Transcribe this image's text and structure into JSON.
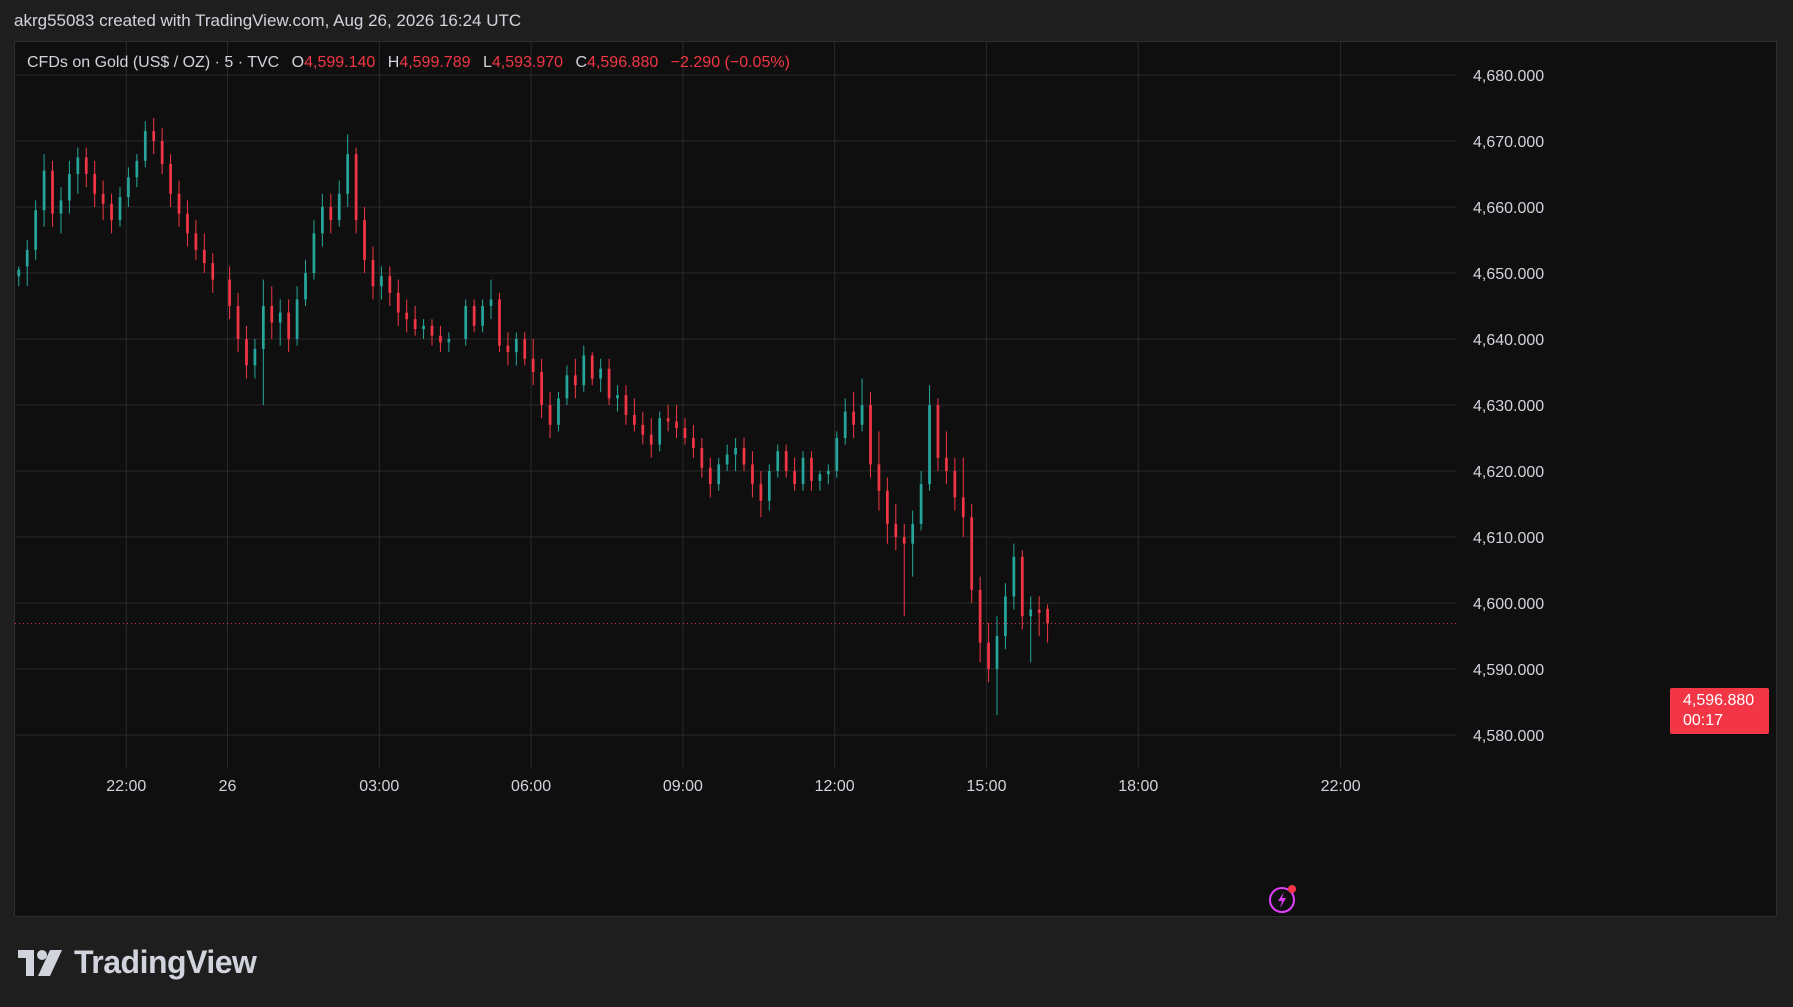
{
  "header": {
    "attribution": "akrg55083 created with TradingView.com, Aug 26, 2026 16:24 UTC"
  },
  "legend": {
    "symbol": "CFDs on Gold (US$ / OZ) · 5 · TVC",
    "open_label": "O",
    "open": "4,599.140",
    "high_label": "H",
    "high": "4,599.789",
    "low_label": "L",
    "low": "4,593.970",
    "close_label": "C",
    "close": "4,596.880",
    "change": "−2.290 (−0.05%)"
  },
  "price_badge": {
    "price": "4,596.880",
    "countdown": "00:17"
  },
  "brand": {
    "name": "TradingView"
  },
  "colors": {
    "up": "#26a69a",
    "down": "#f23645",
    "grid": "#2a2a2a",
    "background": "#0f0f0f",
    "text": "#d1d4dc",
    "bolt": "#e040fb"
  },
  "icons": {
    "alert": "lightning-icon",
    "logo": "tradingview-logo-icon"
  },
  "chart_data": {
    "type": "candlestick",
    "interval_minutes": 5,
    "ylim": [
      4575,
      4685
    ],
    "yticks": [
      4580,
      4590,
      4600,
      4610,
      4620,
      4630,
      4640,
      4650,
      4660,
      4670,
      4680
    ],
    "ytick_labels": [
      "4,580.000",
      "4,590.000",
      "4,600.000",
      "4,610.000",
      "4,620.000",
      "4,630.000",
      "4,640.000",
      "4,650.000",
      "4,660.000",
      "4,670.000",
      "4,680.000"
    ],
    "x_ticks": [
      {
        "label": "22:00",
        "hours": -2
      },
      {
        "label": "26",
        "hours": 0
      },
      {
        "label": "03:00",
        "hours": 3
      },
      {
        "label": "06:00",
        "hours": 6
      },
      {
        "label": "09:00",
        "hours": 9
      },
      {
        "label": "12:00",
        "hours": 12
      },
      {
        "label": "15:00",
        "hours": 15
      },
      {
        "label": "18:00",
        "hours": 18
      },
      {
        "label": "22:00",
        "hours": 22
      }
    ],
    "xlim_hours": [
      -4.2,
      24.3
    ],
    "last_price": 4596.88,
    "ohlc": [
      {
        "time": "Aug 25 19:50",
        "o": 4649.5,
        "h": 4651,
        "l": 4648,
        "c": 4650.5
      },
      {
        "time": "Aug 25 20:00",
        "o": 4651,
        "h": 4655,
        "l": 4648,
        "c": 4653.5
      },
      {
        "time": "Aug 25 20:10",
        "o": 4653.5,
        "h": 4661,
        "l": 4652,
        "c": 4659.5
      },
      {
        "time": "Aug 25 20:20",
        "o": 4659.5,
        "h": 4668,
        "l": 4657,
        "c": 4665.5
      },
      {
        "time": "Aug 25 20:30",
        "o": 4665.5,
        "h": 4667,
        "l": 4657,
        "c": 4659
      },
      {
        "time": "Aug 25 20:40",
        "o": 4659,
        "h": 4663,
        "l": 4656,
        "c": 4661
      },
      {
        "time": "Aug 25 20:50",
        "o": 4661,
        "h": 4667,
        "l": 4659,
        "c": 4665
      },
      {
        "time": "Aug 25 21:00",
        "o": 4665,
        "h": 4669,
        "l": 4662,
        "c": 4667.5
      },
      {
        "time": "Aug 25 21:10",
        "o": 4667.5,
        "h": 4669,
        "l": 4663,
        "c": 4665
      },
      {
        "time": "Aug 25 21:20",
        "o": 4665,
        "h": 4667,
        "l": 4660,
        "c": 4662
      },
      {
        "time": "Aug 25 21:30",
        "o": 4662,
        "h": 4664,
        "l": 4658,
        "c": 4660.5
      },
      {
        "time": "Aug 25 21:40",
        "o": 4660.5,
        "h": 4662,
        "l": 4656,
        "c": 4658
      },
      {
        "time": "Aug 25 21:50",
        "o": 4658,
        "h": 4663,
        "l": 4657,
        "c": 4661.5
      },
      {
        "time": "Aug 25 22:00",
        "o": 4661.5,
        "h": 4666,
        "l": 4660,
        "c": 4664.5
      },
      {
        "time": "Aug 25 22:10",
        "o": 4664.5,
        "h": 4668,
        "l": 4663,
        "c": 4667
      },
      {
        "time": "Aug 25 22:20",
        "o": 4667,
        "h": 4673,
        "l": 4666,
        "c": 4671.5
      },
      {
        "time": "Aug 25 22:30",
        "o": 4671.5,
        "h": 4673.5,
        "l": 4668,
        "c": 4670
      },
      {
        "time": "Aug 25 22:40",
        "o": 4670,
        "h": 4672,
        "l": 4665,
        "c": 4666.5
      },
      {
        "time": "Aug 25 22:50",
        "o": 4666.5,
        "h": 4668,
        "l": 4660,
        "c": 4662
      },
      {
        "time": "Aug 25 23:00",
        "o": 4662,
        "h": 4664,
        "l": 4657,
        "c": 4659
      },
      {
        "time": "Aug 25 23:10",
        "o": 4659,
        "h": 4661,
        "l": 4654,
        "c": 4656
      },
      {
        "time": "Aug 25 23:20",
        "o": 4656,
        "h": 4658,
        "l": 4652,
        "c": 4653.5
      },
      {
        "time": "Aug 25 23:30",
        "o": 4653.5,
        "h": 4656,
        "l": 4650,
        "c": 4651.5
      },
      {
        "time": "Aug 25 23:40",
        "o": 4651.5,
        "h": 4653,
        "l": 4647,
        "c": 4649
      },
      {
        "time": "Aug 26 00:00",
        "o": 4649,
        "h": 4651,
        "l": 4643,
        "c": 4645
      },
      {
        "time": "Aug 26 00:10",
        "o": 4645,
        "h": 4647,
        "l": 4638,
        "c": 4640
      },
      {
        "time": "Aug 26 00:20",
        "o": 4640,
        "h": 4642,
        "l": 4634,
        "c": 4636
      },
      {
        "time": "Aug 26 00:30",
        "o": 4636,
        "h": 4640,
        "l": 4634,
        "c": 4638.5
      },
      {
        "time": "Aug 26 00:40",
        "o": 4638.5,
        "h": 4649,
        "l": 4630,
        "c": 4645
      },
      {
        "time": "Aug 26 00:50",
        "o": 4645,
        "h": 4648,
        "l": 4640,
        "c": 4642.5
      },
      {
        "time": "Aug 26 01:00",
        "o": 4642.5,
        "h": 4646,
        "l": 4639,
        "c": 4644
      },
      {
        "time": "Aug 26 01:10",
        "o": 4644,
        "h": 4646,
        "l": 4638,
        "c": 4640
      },
      {
        "time": "Aug 26 01:20",
        "o": 4640,
        "h": 4648,
        "l": 4639,
        "c": 4646
      },
      {
        "time": "Aug 26 01:30",
        "o": 4646,
        "h": 4652,
        "l": 4645,
        "c": 4650
      },
      {
        "time": "Aug 26 01:40",
        "o": 4650,
        "h": 4658,
        "l": 4649,
        "c": 4656
      },
      {
        "time": "Aug 26 01:50",
        "o": 4656,
        "h": 4662,
        "l": 4654,
        "c": 4660
      },
      {
        "time": "Aug 26 02:00",
        "o": 4660,
        "h": 4662,
        "l": 4656,
        "c": 4658
      },
      {
        "time": "Aug 26 02:10",
        "o": 4658,
        "h": 4664,
        "l": 4657,
        "c": 4662
      },
      {
        "time": "Aug 26 02:20",
        "o": 4662,
        "h": 4671,
        "l": 4660,
        "c": 4668
      },
      {
        "time": "Aug 26 02:30",
        "o": 4668,
        "h": 4669,
        "l": 4656,
        "c": 4658
      },
      {
        "time": "Aug 26 02:40",
        "o": 4658,
        "h": 4660,
        "l": 4650,
        "c": 4652
      },
      {
        "time": "Aug 26 02:50",
        "o": 4652,
        "h": 4654,
        "l": 4646,
        "c": 4648
      },
      {
        "time": "Aug 26 03:00",
        "o": 4648,
        "h": 4651,
        "l": 4646,
        "c": 4649.5
      },
      {
        "time": "Aug 26 03:10",
        "o": 4649.5,
        "h": 4651,
        "l": 4645,
        "c": 4647
      },
      {
        "time": "Aug 26 03:20",
        "o": 4647,
        "h": 4649,
        "l": 4642,
        "c": 4644
      },
      {
        "time": "Aug 26 03:30",
        "o": 4644,
        "h": 4646,
        "l": 4641,
        "c": 4643
      },
      {
        "time": "Aug 26 03:40",
        "o": 4643,
        "h": 4645,
        "l": 4640.5,
        "c": 4641.5
      },
      {
        "time": "Aug 26 03:50",
        "o": 4641.5,
        "h": 4643,
        "l": 4640,
        "c": 4642
      },
      {
        "time": "Aug 26 04:00",
        "o": 4642,
        "h": 4643,
        "l": 4639,
        "c": 4640.5
      },
      {
        "time": "Aug 26 04:10",
        "o": 4640.5,
        "h": 4642,
        "l": 4638,
        "c": 4639.5
      },
      {
        "time": "Aug 26 04:20",
        "o": 4639.5,
        "h": 4641,
        "l": 4638,
        "c": 4640
      },
      {
        "time": "Aug 26 04:40",
        "o": 4640,
        "h": 4646,
        "l": 4639,
        "c": 4645
      },
      {
        "time": "Aug 26 04:50",
        "o": 4645,
        "h": 4646,
        "l": 4641,
        "c": 4642
      },
      {
        "time": "Aug 26 05:00",
        "o": 4642,
        "h": 4646,
        "l": 4641,
        "c": 4645
      },
      {
        "time": "Aug 26 05:10",
        "o": 4645,
        "h": 4649,
        "l": 4643,
        "c": 4646
      },
      {
        "time": "Aug 26 05:20",
        "o": 4646,
        "h": 4647,
        "l": 4638,
        "c": 4639
      },
      {
        "time": "Aug 26 05:30",
        "o": 4639,
        "h": 4641,
        "l": 4636,
        "c": 4638
      },
      {
        "time": "Aug 26 05:40",
        "o": 4638,
        "h": 4641,
        "l": 4636,
        "c": 4640
      },
      {
        "time": "Aug 26 05:50",
        "o": 4640,
        "h": 4641,
        "l": 4636,
        "c": 4637
      },
      {
        "time": "Aug 26 06:00",
        "o": 4637,
        "h": 4640,
        "l": 4633,
        "c": 4635
      },
      {
        "time": "Aug 26 06:10",
        "o": 4635,
        "h": 4637,
        "l": 4628,
        "c": 4630
      },
      {
        "time": "Aug 26 06:20",
        "o": 4630,
        "h": 4632,
        "l": 4625,
        "c": 4627
      },
      {
        "time": "Aug 26 06:30",
        "o": 4627,
        "h": 4632,
        "l": 4626,
        "c": 4631
      },
      {
        "time": "Aug 26 06:40",
        "o": 4631,
        "h": 4636,
        "l": 4630,
        "c": 4634.5
      },
      {
        "time": "Aug 26 06:50",
        "o": 4634.5,
        "h": 4637,
        "l": 4631,
        "c": 4633
      },
      {
        "time": "Aug 26 07:00",
        "o": 4633,
        "h": 4639,
        "l": 4632,
        "c": 4637.5
      },
      {
        "time": "Aug 26 07:10",
        "o": 4637.5,
        "h": 4638,
        "l": 4633,
        "c": 4634
      },
      {
        "time": "Aug 26 07:20",
        "o": 4634,
        "h": 4637,
        "l": 4632,
        "c": 4635.5
      },
      {
        "time": "Aug 26 07:30",
        "o": 4635.5,
        "h": 4637,
        "l": 4630,
        "c": 4631
      },
      {
        "time": "Aug 26 07:40",
        "o": 4631,
        "h": 4633,
        "l": 4629,
        "c": 4631.5
      },
      {
        "time": "Aug 26 07:50",
        "o": 4631.5,
        "h": 4633,
        "l": 4627,
        "c": 4628.5
      },
      {
        "time": "Aug 26 08:00",
        "o": 4628.5,
        "h": 4631,
        "l": 4626,
        "c": 4627
      },
      {
        "time": "Aug 26 08:10",
        "o": 4627,
        "h": 4629,
        "l": 4624,
        "c": 4625.5
      },
      {
        "time": "Aug 26 08:20",
        "o": 4625.5,
        "h": 4628,
        "l": 4622,
        "c": 4624
      },
      {
        "time": "Aug 26 08:30",
        "o": 4624,
        "h": 4629,
        "l": 4623,
        "c": 4628
      },
      {
        "time": "Aug 26 08:40",
        "o": 4628,
        "h": 4630,
        "l": 4626,
        "c": 4627.5
      },
      {
        "time": "Aug 26 08:50",
        "o": 4627.5,
        "h": 4630,
        "l": 4625,
        "c": 4626.5
      },
      {
        "time": "Aug 26 09:00",
        "o": 4626.5,
        "h": 4628,
        "l": 4624,
        "c": 4625
      },
      {
        "time": "Aug 26 09:10",
        "o": 4625,
        "h": 4627,
        "l": 4622,
        "c": 4623.5
      },
      {
        "time": "Aug 26 09:20",
        "o": 4623.5,
        "h": 4625,
        "l": 4619,
        "c": 4620.5
      },
      {
        "time": "Aug 26 09:30",
        "o": 4620.5,
        "h": 4622,
        "l": 4616,
        "c": 4618
      },
      {
        "time": "Aug 26 09:40",
        "o": 4618,
        "h": 4622,
        "l": 4617,
        "c": 4621
      },
      {
        "time": "Aug 26 09:50",
        "o": 4621,
        "h": 4624,
        "l": 4620,
        "c": 4622.5
      },
      {
        "time": "Aug 26 10:00",
        "o": 4622.5,
        "h": 4625,
        "l": 4620,
        "c": 4623.5
      },
      {
        "time": "Aug 26 10:10",
        "o": 4623.5,
        "h": 4625,
        "l": 4620,
        "c": 4621
      },
      {
        "time": "Aug 26 10:20",
        "o": 4621,
        "h": 4623,
        "l": 4616,
        "c": 4618
      },
      {
        "time": "Aug 26 10:30",
        "o": 4618,
        "h": 4620,
        "l": 4613,
        "c": 4615.5
      },
      {
        "time": "Aug 26 10:40",
        "o": 4615.5,
        "h": 4621,
        "l": 4614,
        "c": 4620
      },
      {
        "time": "Aug 26 10:50",
        "o": 4620,
        "h": 4624,
        "l": 4619,
        "c": 4623
      },
      {
        "time": "Aug 26 11:00",
        "o": 4623,
        "h": 4624,
        "l": 4619,
        "c": 4620
      },
      {
        "time": "Aug 26 11:10",
        "o": 4620,
        "h": 4622,
        "l": 4617,
        "c": 4618
      },
      {
        "time": "Aug 26 11:20",
        "o": 4618,
        "h": 4623,
        "l": 4617,
        "c": 4622
      },
      {
        "time": "Aug 26 11:30",
        "o": 4622,
        "h": 4623,
        "l": 4617,
        "c": 4618.5
      },
      {
        "time": "Aug 26 11:40",
        "o": 4618.5,
        "h": 4620,
        "l": 4617,
        "c": 4619.5
      },
      {
        "time": "Aug 26 11:50",
        "o": 4619.5,
        "h": 4621,
        "l": 4618,
        "c": 4620
      },
      {
        "time": "Aug 26 12:00",
        "o": 4620,
        "h": 4626,
        "l": 4619,
        "c": 4625
      },
      {
        "time": "Aug 26 12:10",
        "o": 4625,
        "h": 4631,
        "l": 4624,
        "c": 4629
      },
      {
        "time": "Aug 26 12:20",
        "o": 4629,
        "h": 4632,
        "l": 4625,
        "c": 4627
      },
      {
        "time": "Aug 26 12:30",
        "o": 4627,
        "h": 4634,
        "l": 4626,
        "c": 4630
      },
      {
        "time": "Aug 26 12:40",
        "o": 4630,
        "h": 4632,
        "l": 4619,
        "c": 4621
      },
      {
        "time": "Aug 26 12:50",
        "o": 4621,
        "h": 4626,
        "l": 4614,
        "c": 4617
      },
      {
        "time": "Aug 26 13:00",
        "o": 4617,
        "h": 4619,
        "l": 4609,
        "c": 4612
      },
      {
        "time": "Aug 26 13:10",
        "o": 4612,
        "h": 4615,
        "l": 4608,
        "c": 4610
      },
      {
        "time": "Aug 26 13:20",
        "o": 4610,
        "h": 4612,
        "l": 4598,
        "c": 4609
      },
      {
        "time": "Aug 26 13:30",
        "o": 4609,
        "h": 4614,
        "l": 4604,
        "c": 4612
      },
      {
        "time": "Aug 26 13:40",
        "o": 4612,
        "h": 4620,
        "l": 4611,
        "c": 4618
      },
      {
        "time": "Aug 26 13:50",
        "o": 4618,
        "h": 4633,
        "l": 4617,
        "c": 4630
      },
      {
        "time": "Aug 26 14:00",
        "o": 4630,
        "h": 4631,
        "l": 4620,
        "c": 4622
      },
      {
        "time": "Aug 26 14:10",
        "o": 4622,
        "h": 4626,
        "l": 4618,
        "c": 4620
      },
      {
        "time": "Aug 26 14:20",
        "o": 4620,
        "h": 4622,
        "l": 4614,
        "c": 4616
      },
      {
        "time": "Aug 26 14:30",
        "o": 4616,
        "h": 4622,
        "l": 4610,
        "c": 4613
      },
      {
        "time": "Aug 26 14:40",
        "o": 4613,
        "h": 4615,
        "l": 4600,
        "c": 4602
      },
      {
        "time": "Aug 26 14:50",
        "o": 4602,
        "h": 4604,
        "l": 4591,
        "c": 4594
      },
      {
        "time": "Aug 26 15:00",
        "o": 4594,
        "h": 4597,
        "l": 4588,
        "c": 4590
      },
      {
        "time": "Aug 26 15:10",
        "o": 4590,
        "h": 4598,
        "l": 4583,
        "c": 4595
      },
      {
        "time": "Aug 26 15:20",
        "o": 4595,
        "h": 4603,
        "l": 4593,
        "c": 4601
      },
      {
        "time": "Aug 26 15:30",
        "o": 4601,
        "h": 4609,
        "l": 4599,
        "c": 4607
      },
      {
        "time": "Aug 26 15:40",
        "o": 4607,
        "h": 4608,
        "l": 4596,
        "c": 4598
      },
      {
        "time": "Aug 26 15:50",
        "o": 4598,
        "h": 4601,
        "l": 4591,
        "c": 4599
      },
      {
        "time": "Aug 26 16:00",
        "o": 4599,
        "h": 4601,
        "l": 4595,
        "c": 4598.5
      },
      {
        "time": "Aug 26 16:10",
        "o": 4599.1,
        "h": 4599.8,
        "l": 4594,
        "c": 4596.9
      }
    ]
  }
}
